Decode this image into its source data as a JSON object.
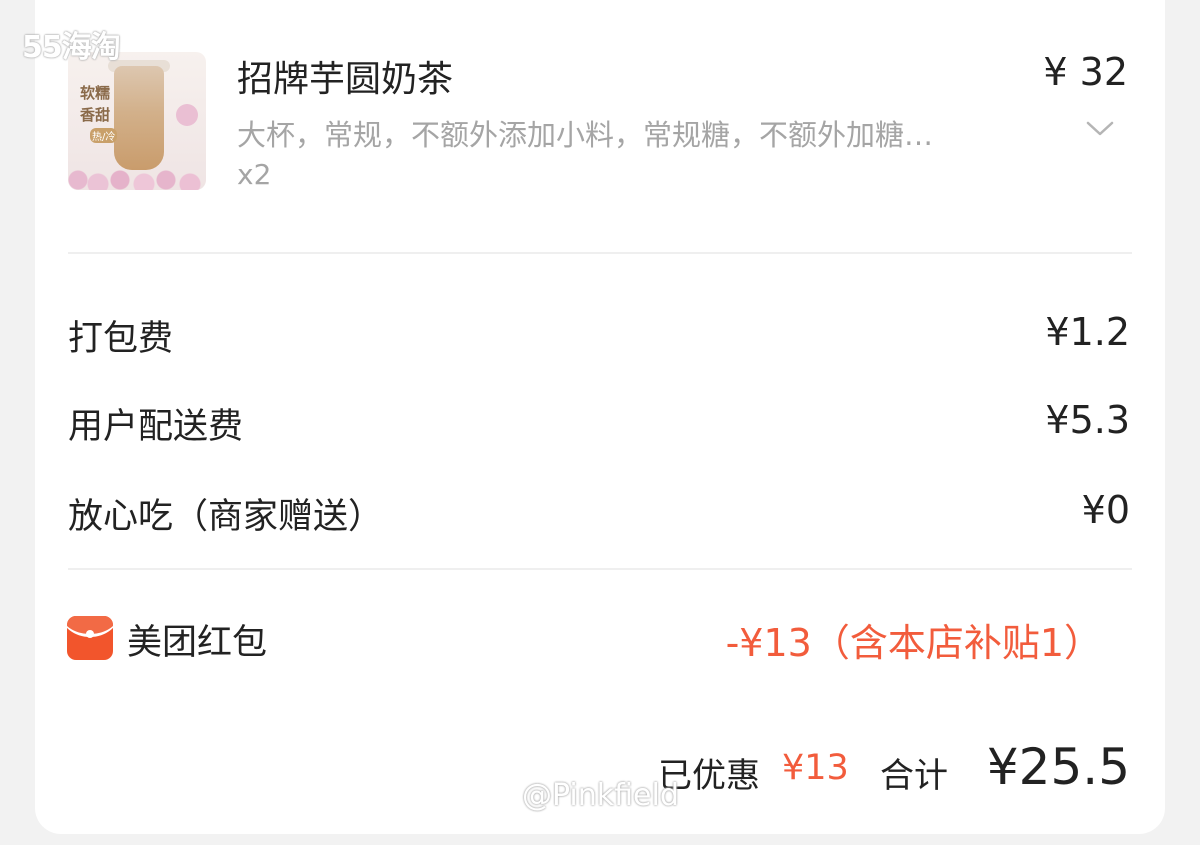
{
  "watermarks": {
    "top_left": "55海淘",
    "bottom": "@Pinkfield"
  },
  "product": {
    "image_tags": [
      "软糯",
      "香甜",
      "热/冷"
    ],
    "name": "招牌芋圆奶茶",
    "price": "¥ 32",
    "specs": "大杯，常规，不额外添加小料，常规糖，不额外加糖…",
    "quantity": "x2",
    "expand_icon": "chevron-down-icon"
  },
  "fees": [
    {
      "label": "打包费",
      "value": "¥1.2"
    },
    {
      "label": "用户配送费",
      "value": "¥5.3"
    },
    {
      "label": "放心吃（商家赠送）",
      "value": "¥0"
    }
  ],
  "red_packet": {
    "icon": "red-envelope-icon",
    "label": "美团红包",
    "value": "-¥13（含本店补贴1）"
  },
  "summary": {
    "discount_label": "已优惠",
    "discount_value": "¥13",
    "total_label": "合计",
    "total_value": "¥25.5"
  },
  "colors": {
    "accent_red": "#f25c3c",
    "text_primary": "#222222",
    "text_secondary": "#a5a5a5",
    "background": "#f2f2f2"
  }
}
